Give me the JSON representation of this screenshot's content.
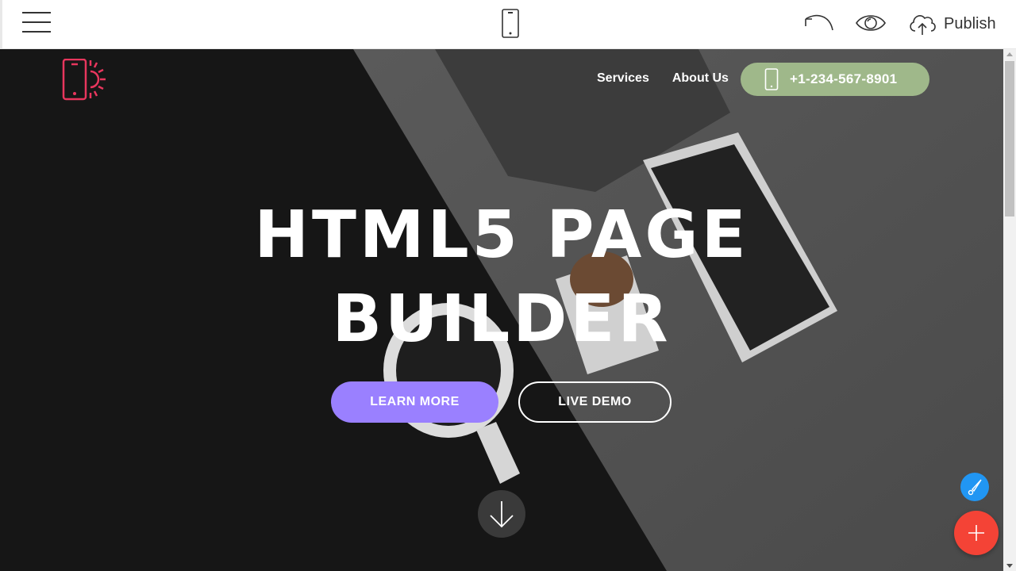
{
  "toolbar": {
    "menu_icon": "hamburger-icon",
    "device_icon": "mobile-phone-icon",
    "undo_icon": "undo-icon",
    "preview_icon": "eye-icon",
    "publish_icon": "cloud-upload-icon",
    "publish_label": "Publish"
  },
  "site": {
    "logo_icon": "phone-sun-icon",
    "logo_color": "#e8365d",
    "nav": [
      {
        "label": "Services"
      },
      {
        "label": "About Us"
      }
    ],
    "phone_button": {
      "icon": "mobile-phone-icon",
      "label": "+1-234-567-8901",
      "color": "#9fb88a"
    },
    "headline_line1": "HTML5 PAGE",
    "headline_line2": "BUILDER",
    "buttons": {
      "learn_more": {
        "label": "LEARN MORE",
        "color": "#9a80ff"
      },
      "live_demo": {
        "label": "LIVE DEMO"
      }
    },
    "scroll_down_icon": "arrow-down-icon"
  },
  "fabs": {
    "brush_icon": "paint-brush-icon",
    "brush_color": "#2196f3",
    "add_icon": "plus-icon",
    "add_color": "#f44336"
  }
}
